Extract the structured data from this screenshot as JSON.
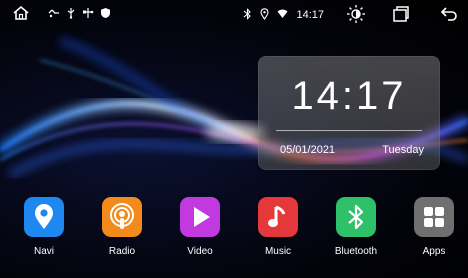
{
  "status_bar": {
    "time": "14:17"
  },
  "clock_widget": {
    "time": "14:17",
    "date": "05/01/2021",
    "day": "Tuesday"
  },
  "apps": [
    {
      "label": "Navi",
      "color": "#1e88f0",
      "icon": "location-pin-icon"
    },
    {
      "label": "Radio",
      "color": "#f28a1c",
      "icon": "podcast-icon"
    },
    {
      "label": "Video",
      "color": "#c23adf",
      "icon": "play-icon"
    },
    {
      "label": "Music",
      "color": "#e5383b",
      "icon": "music-note-icon"
    },
    {
      "label": "Bluetooth",
      "color": "#2fc06a",
      "icon": "bluetooth-icon"
    },
    {
      "label": "Apps",
      "color": "#6f6f6f",
      "icon": "grid-icon"
    }
  ]
}
